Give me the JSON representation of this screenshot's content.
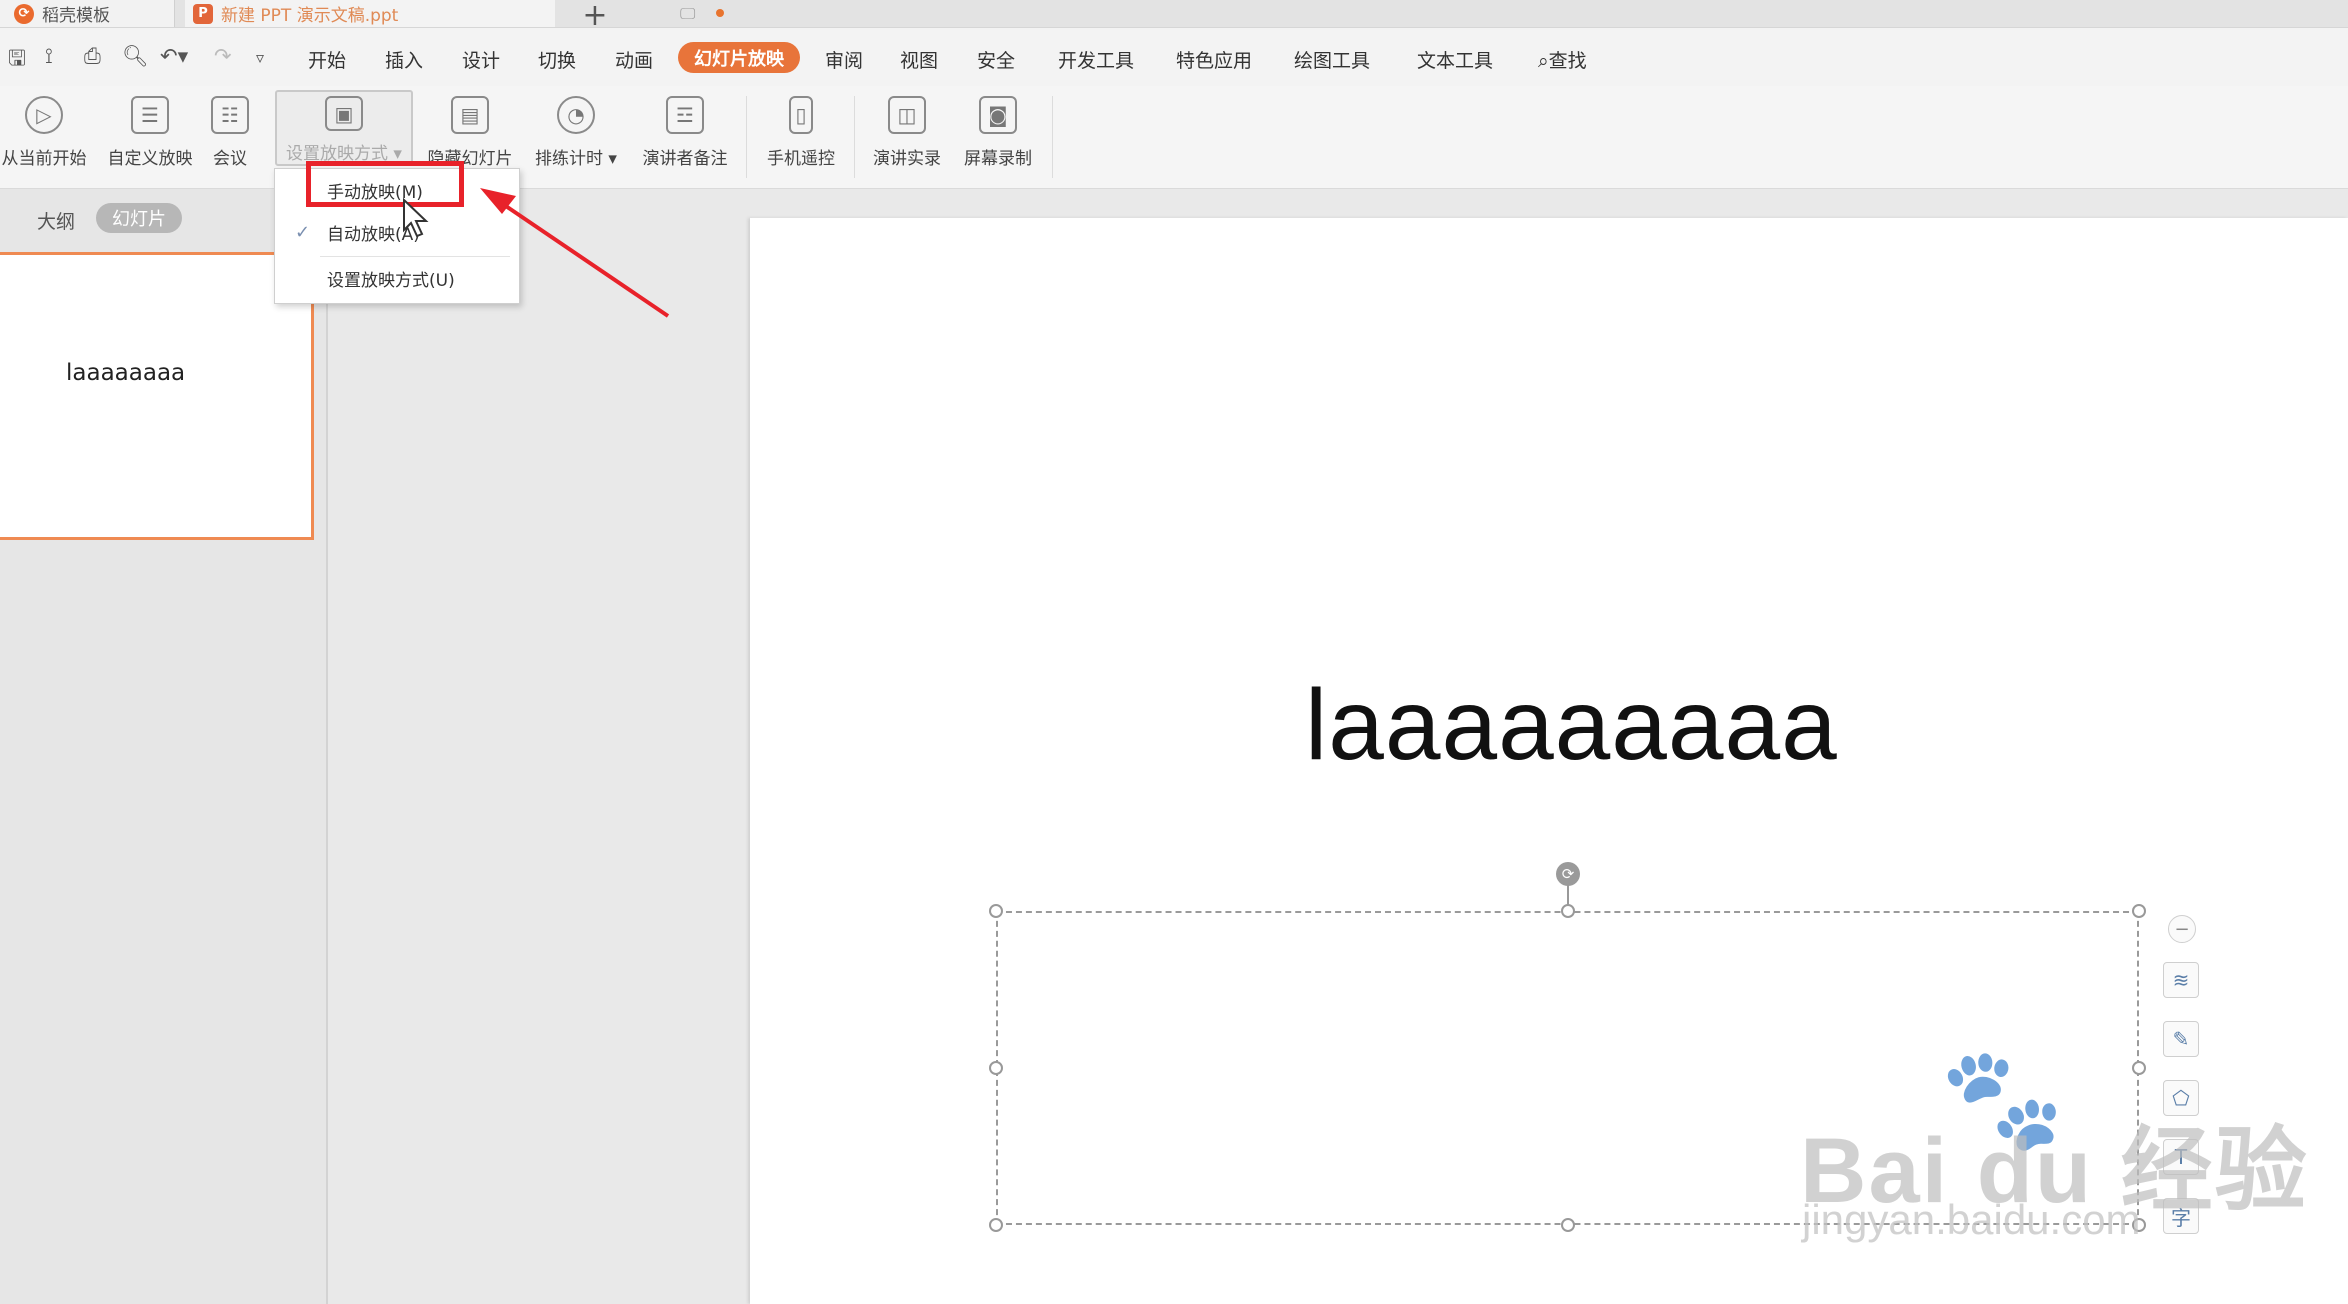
{
  "tabs": [
    {
      "label": "稻壳模板"
    },
    {
      "label": "新建 PPT 演示文稿.ppt"
    }
  ],
  "quick_access": {
    "search_label": "查找"
  },
  "menu": {
    "items": [
      "开始",
      "插入",
      "设计",
      "切换",
      "动画",
      "幻灯片放映",
      "审阅",
      "视图",
      "安全",
      "开发工具",
      "特色应用",
      "绘图工具",
      "文本工具"
    ],
    "active": "幻灯片放映"
  },
  "ribbon": {
    "buttons": [
      {
        "label": "从当前开始",
        "icon": "play-circle-icon"
      },
      {
        "label": "自定义放映",
        "icon": "custom-show-icon"
      },
      {
        "label": "会议",
        "icon": "meeting-icon"
      },
      {
        "label": "设置放映方式",
        "icon": "slideshow-settings-icon"
      },
      {
        "label": "隐藏幻灯片",
        "icon": "hide-slide-icon"
      },
      {
        "label": "排练计时",
        "icon": "stopwatch-icon"
      },
      {
        "label": "演讲者备注",
        "icon": "speaker-notes-icon"
      },
      {
        "label": "手机遥控",
        "icon": "phone-icon"
      },
      {
        "label": "演讲实录",
        "icon": "video-camera-icon"
      },
      {
        "label": "屏幕录制",
        "icon": "screen-record-icon"
      }
    ]
  },
  "dropdown": {
    "items": [
      {
        "label": "手动放映(M)",
        "checked": false
      },
      {
        "label": "自动放映(A)",
        "checked": true
      },
      {
        "label": "设置放映方式(U)",
        "checked": false
      }
    ]
  },
  "left_panel": {
    "outline_tab": "大纲",
    "slides_tab": "幻灯片",
    "thumbnail_text": "laaaaaaaa"
  },
  "slide": {
    "title": "laaaaaaaaa"
  },
  "watermark": {
    "main": "Bai du 经验",
    "sub": "jingyan.baidu.com"
  },
  "colors": {
    "accent": "#e8743a",
    "highlight_box": "#e8222a",
    "arrow": "#e8222a"
  }
}
